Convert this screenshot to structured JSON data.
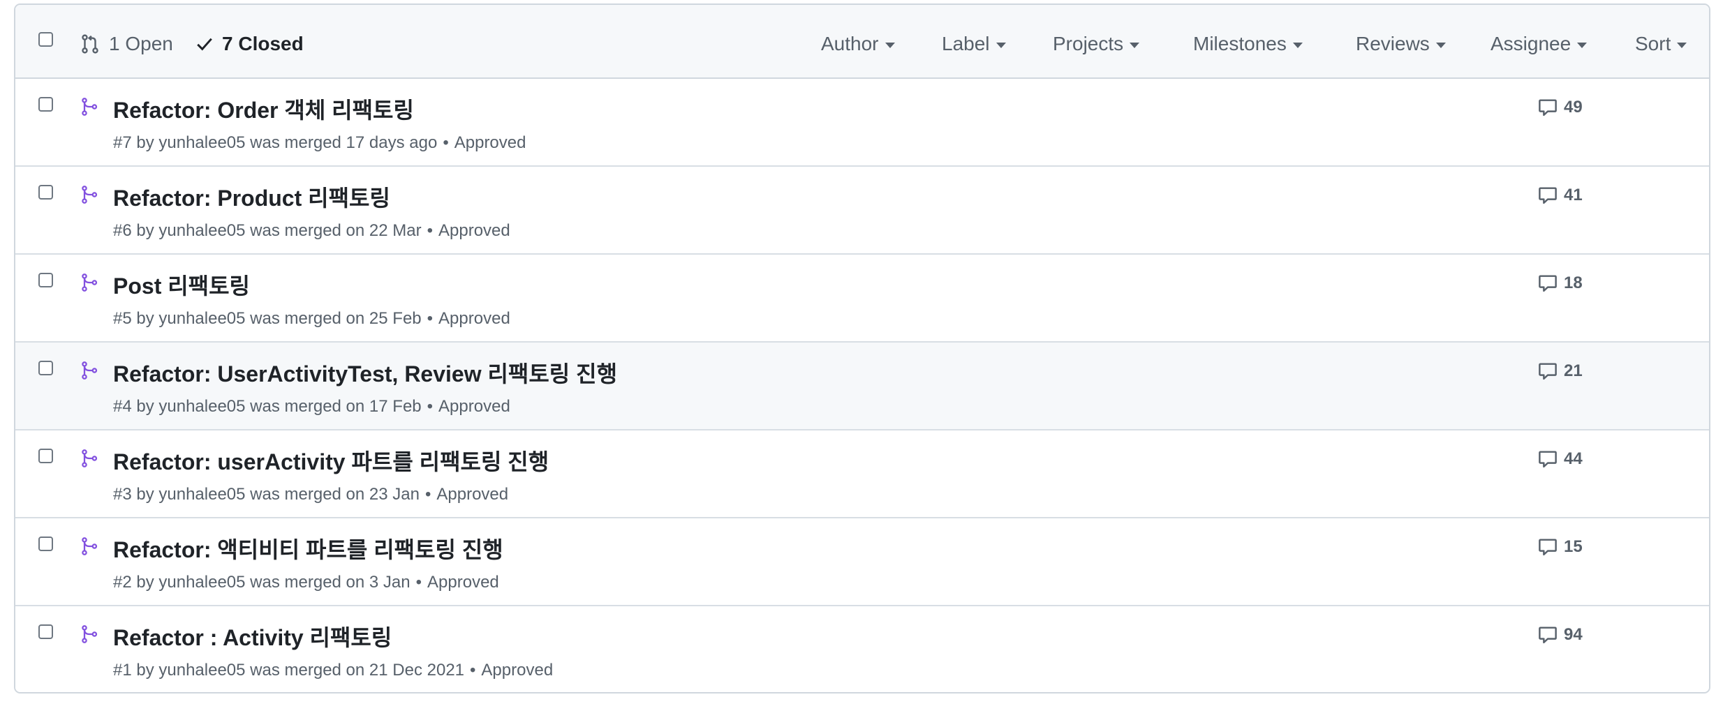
{
  "header": {
    "open_count": "1 Open",
    "closed_count": "7 Closed",
    "filters": [
      "Author",
      "Label",
      "Projects",
      "Milestones",
      "Reviews",
      "Assignee",
      "Sort"
    ]
  },
  "pull_requests": [
    {
      "title": "Refactor: Order 객체 리팩토링",
      "meta": "#7 by yunhalee05 was merged 17 days ago",
      "review": "Approved",
      "comments": "49"
    },
    {
      "title": "Refactor: Product 리팩토링",
      "meta": "#6 by yunhalee05 was merged on 22 Mar",
      "review": "Approved",
      "comments": "41"
    },
    {
      "title": "Post 리팩토링",
      "meta": "#5 by yunhalee05 was merged on 25 Feb",
      "review": "Approved",
      "comments": "18"
    },
    {
      "title": "Refactor: UserActivityTest, Review 리팩토링 진행",
      "meta": "#4 by yunhalee05 was merged on 17 Feb",
      "review": "Approved",
      "comments": "21"
    },
    {
      "title": "Refactor: userActivity 파트를 리팩토링 진행",
      "meta": "#3 by yunhalee05 was merged on 23 Jan",
      "review": "Approved",
      "comments": "44"
    },
    {
      "title": "Refactor: 액티비티 파트를 리팩토링 진행",
      "meta": "#2 by yunhalee05 was merged on 3 Jan",
      "review": "Approved",
      "comments": "15"
    },
    {
      "title": "Refactor : Activity 리팩토링",
      "meta": "#1 by yunhalee05 was merged on 21 Dec 2021",
      "review": "Approved",
      "comments": "94"
    }
  ],
  "colors": {
    "merged_icon": "#8250df",
    "muted_text": "#57606a",
    "border": "#d0d7de",
    "header_bg": "#f6f8fa"
  }
}
